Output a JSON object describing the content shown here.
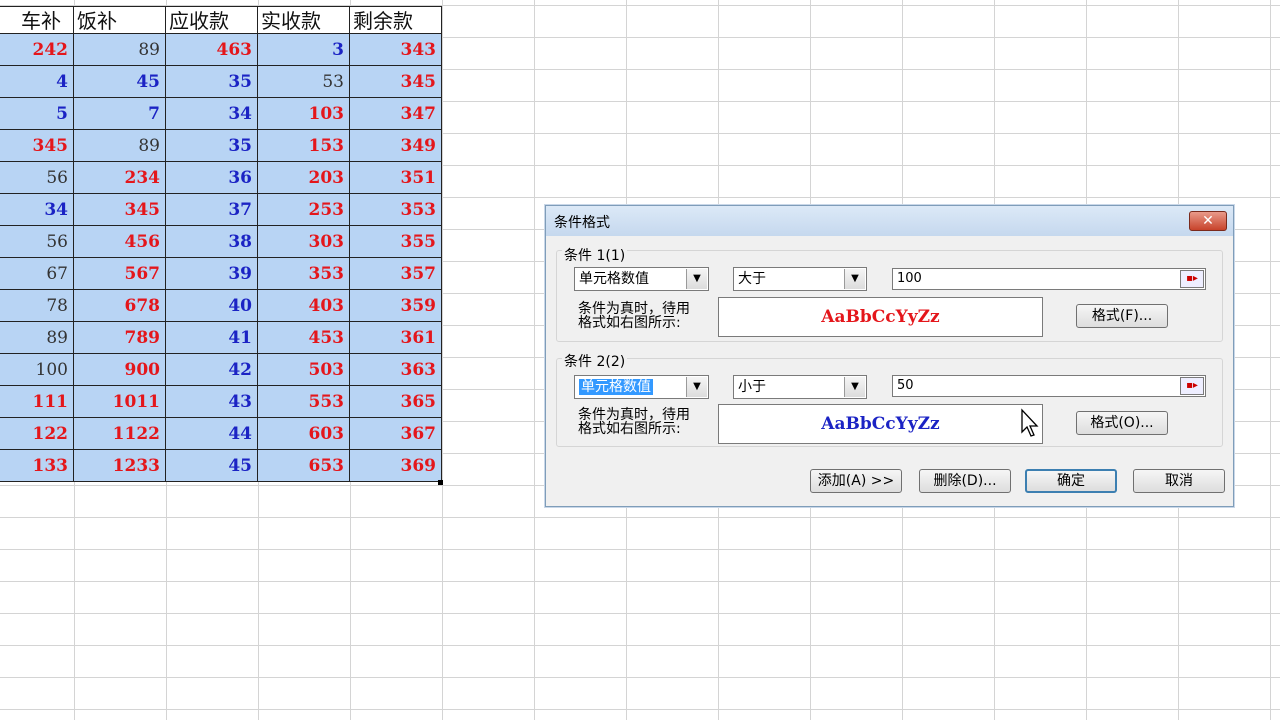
{
  "sheet": {
    "headers": [
      "车补",
      "饭补",
      "应收款",
      "实收款",
      "剩余款"
    ],
    "rows": [
      [
        {
          "v": "242",
          "c": "red"
        },
        {
          "v": "89",
          "c": "plain"
        },
        {
          "v": "463",
          "c": "red"
        },
        {
          "v": "3",
          "c": "blue"
        },
        {
          "v": "343",
          "c": "red"
        }
      ],
      [
        {
          "v": "4",
          "c": "blue"
        },
        {
          "v": "45",
          "c": "blue"
        },
        {
          "v": "35",
          "c": "blue"
        },
        {
          "v": "53",
          "c": "plain"
        },
        {
          "v": "345",
          "c": "red"
        }
      ],
      [
        {
          "v": "5",
          "c": "blue"
        },
        {
          "v": "7",
          "c": "blue"
        },
        {
          "v": "34",
          "c": "blue"
        },
        {
          "v": "103",
          "c": "red"
        },
        {
          "v": "347",
          "c": "red"
        }
      ],
      [
        {
          "v": "345",
          "c": "red"
        },
        {
          "v": "89",
          "c": "plain"
        },
        {
          "v": "35",
          "c": "blue"
        },
        {
          "v": "153",
          "c": "red"
        },
        {
          "v": "349",
          "c": "red"
        }
      ],
      [
        {
          "v": "56",
          "c": "plain"
        },
        {
          "v": "234",
          "c": "red"
        },
        {
          "v": "36",
          "c": "blue"
        },
        {
          "v": "203",
          "c": "red"
        },
        {
          "v": "351",
          "c": "red"
        }
      ],
      [
        {
          "v": "34",
          "c": "blue"
        },
        {
          "v": "345",
          "c": "red"
        },
        {
          "v": "37",
          "c": "blue"
        },
        {
          "v": "253",
          "c": "red"
        },
        {
          "v": "353",
          "c": "red"
        }
      ],
      [
        {
          "v": "56",
          "c": "plain"
        },
        {
          "v": "456",
          "c": "red"
        },
        {
          "v": "38",
          "c": "blue"
        },
        {
          "v": "303",
          "c": "red"
        },
        {
          "v": "355",
          "c": "red"
        }
      ],
      [
        {
          "v": "67",
          "c": "plain"
        },
        {
          "v": "567",
          "c": "red"
        },
        {
          "v": "39",
          "c": "blue"
        },
        {
          "v": "353",
          "c": "red"
        },
        {
          "v": "357",
          "c": "red"
        }
      ],
      [
        {
          "v": "78",
          "c": "plain"
        },
        {
          "v": "678",
          "c": "red"
        },
        {
          "v": "40",
          "c": "blue"
        },
        {
          "v": "403",
          "c": "red"
        },
        {
          "v": "359",
          "c": "red"
        }
      ],
      [
        {
          "v": "89",
          "c": "plain"
        },
        {
          "v": "789",
          "c": "red"
        },
        {
          "v": "41",
          "c": "blue"
        },
        {
          "v": "453",
          "c": "red"
        },
        {
          "v": "361",
          "c": "red"
        }
      ],
      [
        {
          "v": "100",
          "c": "plain"
        },
        {
          "v": "900",
          "c": "red"
        },
        {
          "v": "42",
          "c": "blue"
        },
        {
          "v": "503",
          "c": "red"
        },
        {
          "v": "363",
          "c": "red"
        }
      ],
      [
        {
          "v": "111",
          "c": "red"
        },
        {
          "v": "1011",
          "c": "red"
        },
        {
          "v": "43",
          "c": "blue"
        },
        {
          "v": "553",
          "c": "red"
        },
        {
          "v": "365",
          "c": "red"
        }
      ],
      [
        {
          "v": "122",
          "c": "red"
        },
        {
          "v": "1122",
          "c": "red"
        },
        {
          "v": "44",
          "c": "blue"
        },
        {
          "v": "603",
          "c": "red"
        },
        {
          "v": "367",
          "c": "red"
        }
      ],
      [
        {
          "v": "133",
          "c": "red"
        },
        {
          "v": "1233",
          "c": "red"
        },
        {
          "v": "45",
          "c": "blue"
        },
        {
          "v": "653",
          "c": "red"
        },
        {
          "v": "369",
          "c": "red"
        }
      ]
    ]
  },
  "dialog": {
    "title": "条件格式",
    "close_label": "✕",
    "condition1": {
      "label": "条件 1(1)",
      "type_value": "单元格数值",
      "operator_value": "大于",
      "value": "100",
      "desc_line1": "条件为真时，待用",
      "desc_line2": "格式如右图所示:",
      "preview_text": "AaBbCcYyZz",
      "format_button": "格式(F)..."
    },
    "condition2": {
      "label": "条件 2(2)",
      "type_value": "单元格数值",
      "operator_value": "小于",
      "value": "50",
      "desc_line1": "条件为真时，待用",
      "desc_line2": "格式如右图所示:",
      "preview_text": "AaBbCcYyZz",
      "format_button": "格式(O)..."
    },
    "buttons": {
      "add": "添加(A) >>",
      "delete": "删除(D)...",
      "ok": "确定",
      "cancel": "取消"
    }
  },
  "colors": {
    "red": "#e4161b",
    "blue": "#1b23c4",
    "cell_fill": "#b8d4f4"
  }
}
